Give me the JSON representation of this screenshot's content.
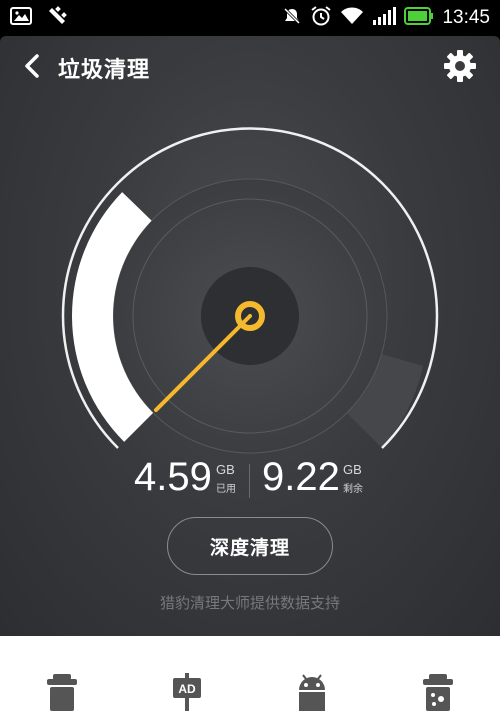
{
  "status_bar": {
    "time": "13:45",
    "icons": [
      "image-icon",
      "usb-icon",
      "mute-icon",
      "alarm-icon",
      "wifi-icon",
      "signal-icon",
      "battery-icon"
    ],
    "battery_color": "#4cd137"
  },
  "header": {
    "title": "垃圾清理",
    "back_icon": "chevron-left-icon",
    "settings_icon": "gear-icon"
  },
  "storage": {
    "used_value": "4.59",
    "used_unit": "GB",
    "used_label": "已用",
    "remaining_value": "9.22",
    "remaining_unit": "GB",
    "remaining_label": "剩余",
    "used_fraction": 0.33
  },
  "actions": {
    "deep_clean_label": "深度清理"
  },
  "footer_note": "猎豹清理大师提供数据支持",
  "bottom_nav": [
    {
      "icon": "trash-icon"
    },
    {
      "icon": "ad-sign-icon"
    },
    {
      "icon": "android-icon"
    },
    {
      "icon": "app-cache-icon"
    }
  ],
  "colors": {
    "accent": "#f5b92e",
    "panel_dark": "#2d2e31",
    "panel_light": "#4a4b4f"
  }
}
